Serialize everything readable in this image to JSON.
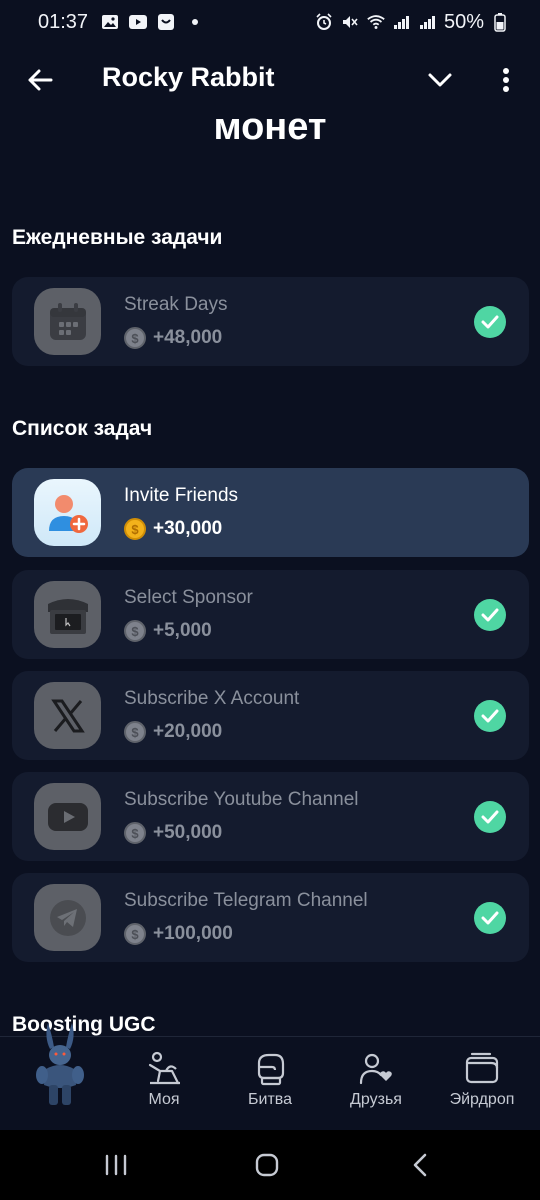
{
  "status_bar": {
    "time": "01:37",
    "battery": "50%"
  },
  "header": {
    "title": "Rocky Rabbit"
  },
  "heading_fragment": "монет",
  "daily": {
    "title": "Ежедневные задачи",
    "tasks": [
      {
        "title": "Streak Days",
        "reward": "+48,000",
        "icon": "calendar-icon",
        "completed": true
      }
    ]
  },
  "task_list": {
    "title": "Список задач",
    "tasks": [
      {
        "title": "Invite Friends",
        "reward": "+30,000",
        "icon": "add-user-icon",
        "completed": false
      },
      {
        "title": "Select Sponsor",
        "reward": "+5,000",
        "icon": "store-icon",
        "completed": true
      },
      {
        "title": "Subscribe X Account",
        "reward": "+20,000",
        "icon": "x-logo-icon",
        "completed": true
      },
      {
        "title": "Subscribe Youtube Channel",
        "reward": "+50,000",
        "icon": "youtube-icon",
        "completed": true
      },
      {
        "title": "Subscribe Telegram Channel",
        "reward": "+100,000",
        "icon": "telegram-icon",
        "completed": true
      }
    ]
  },
  "boosting": {
    "title": "Boosting UGC"
  },
  "bottom_nav": {
    "items": [
      {
        "label": "Моя",
        "icon": "workout-icon"
      },
      {
        "label": "Битва",
        "icon": "boxing-glove-icon"
      },
      {
        "label": "Друзья",
        "icon": "friends-icon"
      },
      {
        "label": "Эйрдроп",
        "icon": "wallet-icon"
      }
    ]
  },
  "colors": {
    "background": "#0b1020",
    "card": "#141b2e",
    "card_active": "#2a3a55",
    "check": "#4fd6a3",
    "coin": "#f3b21b"
  }
}
